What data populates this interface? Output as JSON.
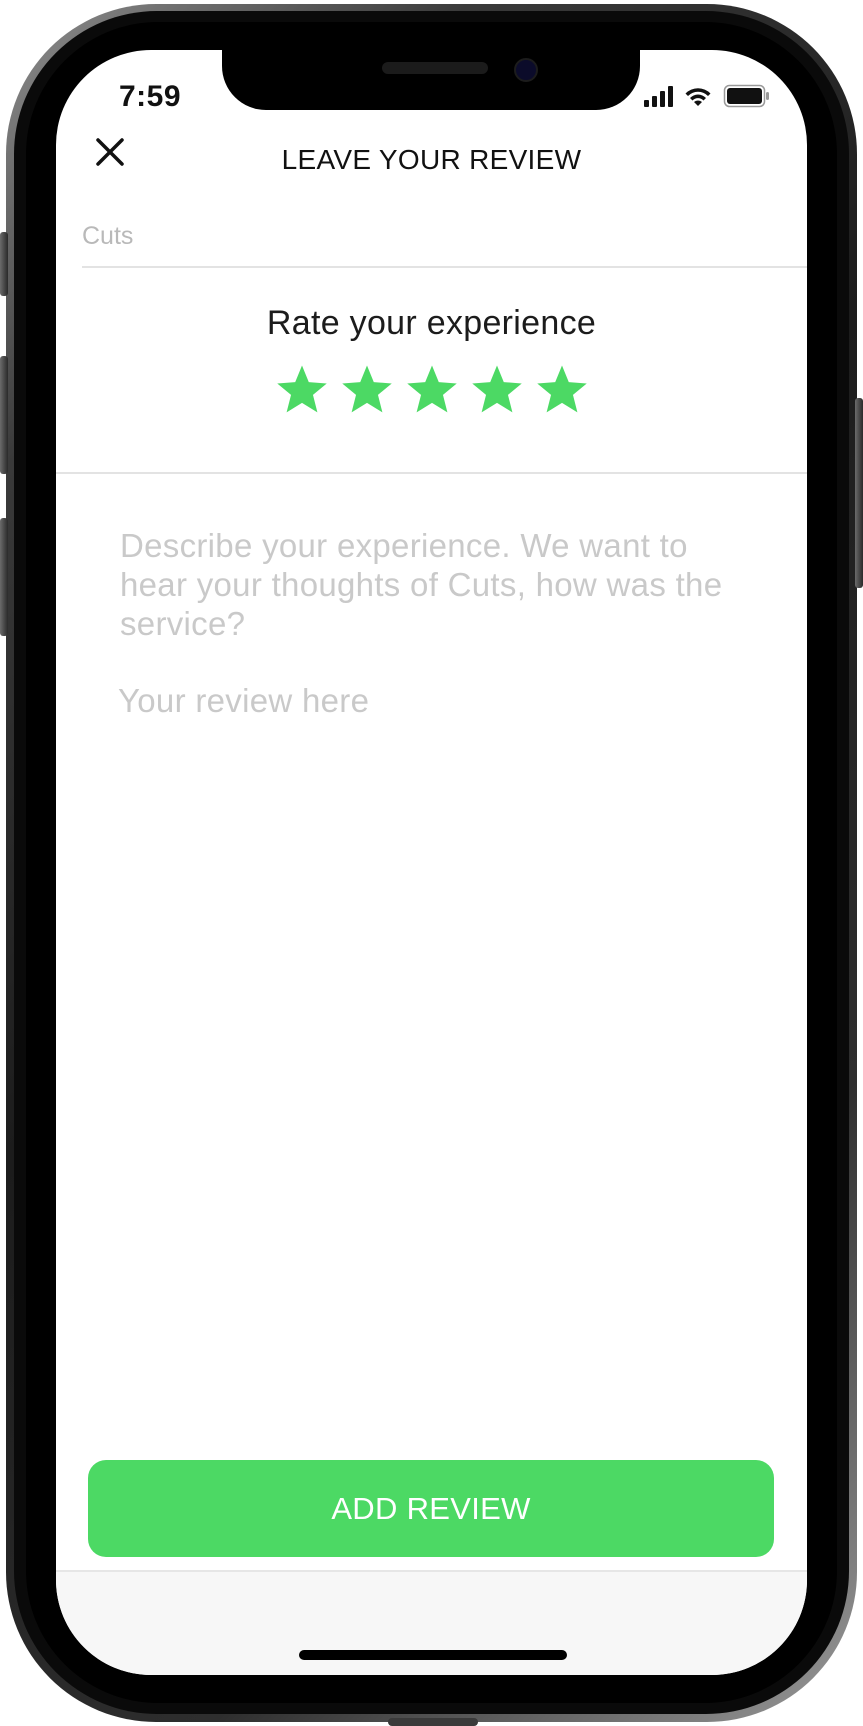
{
  "status_bar": {
    "time": "7:59",
    "icons": [
      "signal-icon",
      "wifi-icon",
      "battery-icon"
    ]
  },
  "header": {
    "title": "LEAVE YOUR REVIEW",
    "close_icon": "close-icon"
  },
  "business": {
    "name": "Cuts"
  },
  "rating": {
    "title": "Rate your experience",
    "value": 5,
    "max": 5,
    "star_color": "#4cd964"
  },
  "review": {
    "prompt": "Describe your experience. We want to hear your thoughts of Cuts, how was the service?",
    "placeholder": "Your review here"
  },
  "actions": {
    "submit_label": "ADD REVIEW",
    "accent_color": "#4cd964"
  }
}
